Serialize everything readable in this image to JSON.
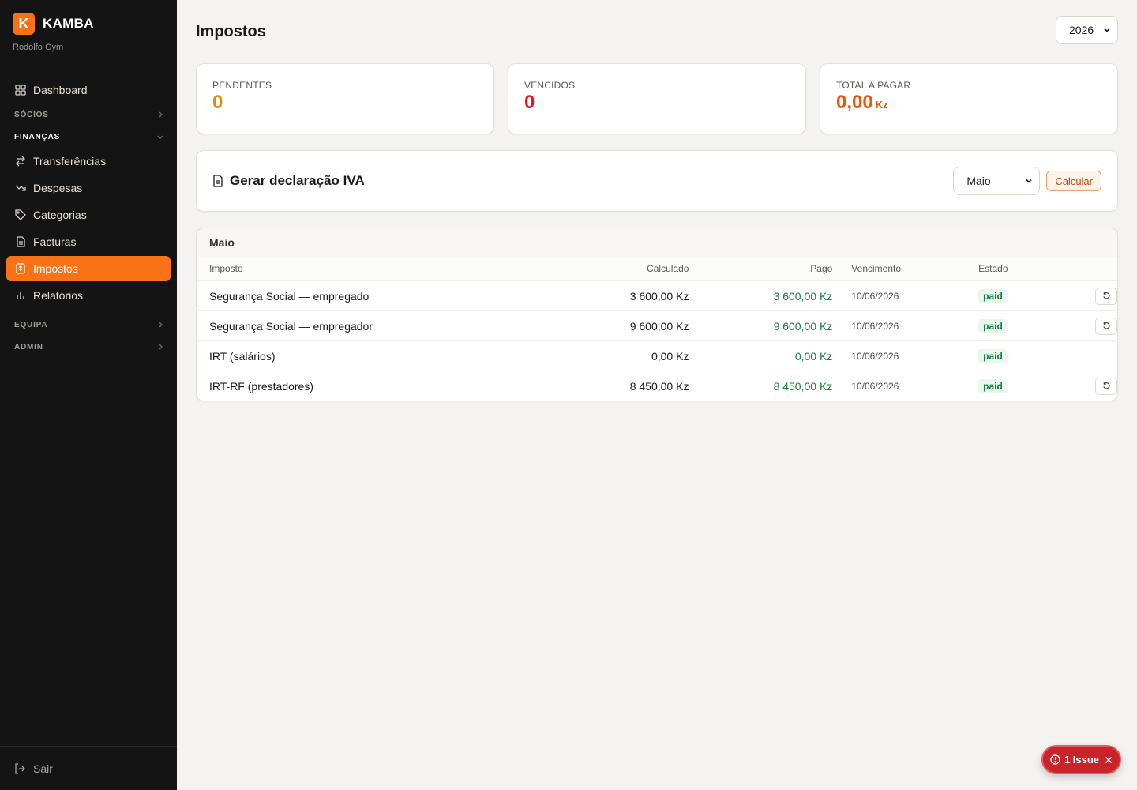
{
  "brand": {
    "name": "KAMBA",
    "logo_letter": "K",
    "subtitle": "Rodolfo Gym",
    "accent": "#f97316"
  },
  "nav": {
    "dashboard": "Dashboard",
    "socios": "SÓCIOS",
    "financas": "FINANÇAS",
    "items": [
      {
        "label": "Transferências",
        "icon": "transfer-icon"
      },
      {
        "label": "Despesas",
        "icon": "trending-down-icon"
      },
      {
        "label": "Categorias",
        "icon": "tag-icon"
      },
      {
        "label": "Facturas",
        "icon": "file-icon"
      },
      {
        "label": "Impostos",
        "icon": "receipt-icon",
        "active": true
      },
      {
        "label": "Relatórios",
        "icon": "bar-chart-icon"
      }
    ],
    "equipa": "EQUIPA",
    "admin": "ADMIN",
    "logout": "Sair"
  },
  "page": {
    "title": "Impostos",
    "year": "2026"
  },
  "cards": {
    "pendentes": {
      "label": "PENDENTES",
      "value": "0"
    },
    "vencidos": {
      "label": "VENCIDOS",
      "value": "0"
    },
    "total": {
      "label": "TOTAL A PAGAR",
      "value": "0,00",
      "unit": "Kz"
    }
  },
  "iva": {
    "title": "Gerar declaração IVA",
    "month": "Maio",
    "button": "Calcular"
  },
  "table": {
    "title": "Maio",
    "headers": {
      "imposto": "Imposto",
      "calculado": "Calculado",
      "pago": "Pago",
      "vencimento": "Vencimento",
      "estado": "Estado"
    },
    "rows": [
      {
        "imposto": "Segurança Social — empregado",
        "calculado": "3 600,00 Kz",
        "pago": "3 600,00 Kz",
        "vencimento": "10/06/2026",
        "estado": "paid"
      },
      {
        "imposto": "Segurança Social — empregador",
        "calculado": "9 600,00 Kz",
        "pago": "9 600,00 Kz",
        "vencimento": "10/06/2026",
        "estado": "paid"
      },
      {
        "imposto": "IRT (salários)",
        "calculado": "0,00 Kz",
        "pago": "0,00 Kz",
        "vencimento": "10/06/2026",
        "estado": "paid"
      },
      {
        "imposto": "IRT-RF (prestadores)",
        "calculado": "8 450,00 Kz",
        "pago": "8 450,00 Kz",
        "vencimento": "10/06/2026",
        "estado": "paid"
      }
    ]
  },
  "issue": {
    "label": "1 Issue",
    "color": "#c8242a"
  }
}
